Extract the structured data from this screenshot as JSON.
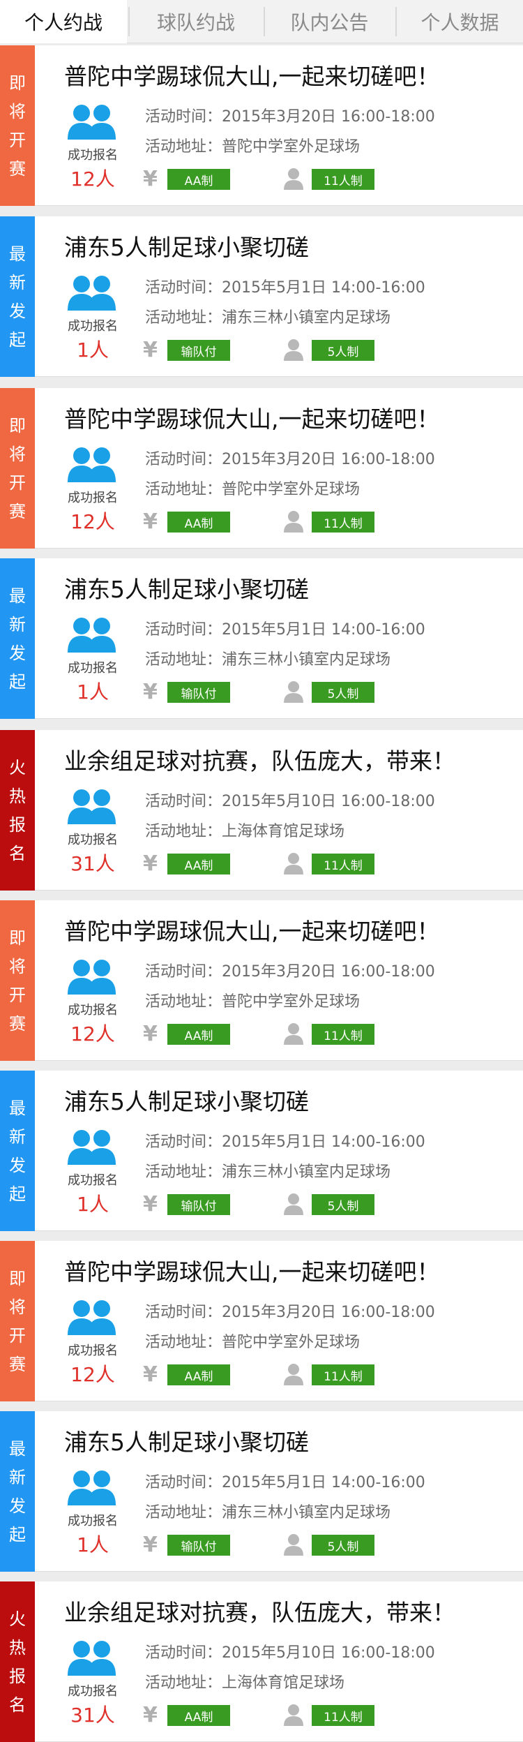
{
  "tabs": [
    "个人约战",
    "球队约战",
    "队内公告",
    "个人数据"
  ],
  "labels": {
    "time_prefix": "活动时间：",
    "address_prefix": "活动地址：",
    "signup": "成功报名",
    "yen": "¥"
  },
  "colors": {
    "status_upcoming": "#f06842",
    "status_new": "#2196f3",
    "status_hot": "#bb0d0d",
    "tag_green": "#3a9b22",
    "count_red": "#e0302a",
    "avatar_blue": "#1aa0e6"
  },
  "icons": [
    "team-avatar-icon",
    "yen-icon",
    "person-icon"
  ],
  "events": [
    {
      "status": [
        "即",
        "将",
        "开",
        "赛"
      ],
      "title": "普陀中学踢球侃大山,一起来切磋吧！",
      "time": "2015年3月20日 16:00-18:00",
      "address": "普陀中学室外足球场",
      "count": "12人",
      "fee": "AA制",
      "size": "11人制"
    },
    {
      "status": [
        "最",
        "新",
        "发",
        "起"
      ],
      "title": "浦东5人制足球小聚切磋",
      "time": "2015年5月1日 14:00-16:00",
      "address": "浦东三林小镇室内足球场",
      "count": "1人",
      "fee": "输队付",
      "size": "5人制"
    },
    {
      "status": [
        "即",
        "将",
        "开",
        "赛"
      ],
      "title": "普陀中学踢球侃大山,一起来切磋吧！",
      "time": "2015年3月20日 16:00-18:00",
      "address": "普陀中学室外足球场",
      "count": "12人",
      "fee": "AA制",
      "size": "11人制"
    },
    {
      "status": [
        "最",
        "新",
        "发",
        "起"
      ],
      "title": "浦东5人制足球小聚切磋",
      "time": "2015年5月1日 14:00-16:00",
      "address": "浦东三林小镇室内足球场",
      "count": "1人",
      "fee": "输队付",
      "size": "5人制"
    },
    {
      "status": [
        "火",
        "热",
        "报",
        "名"
      ],
      "title": "业余组足球对抗赛，队伍庞大，带来！",
      "time": "2015年5月10日 16:00-18:00",
      "address": "上海体育馆足球场",
      "count": "31人",
      "fee": "AA制",
      "size": "11人制"
    },
    {
      "status": [
        "即",
        "将",
        "开",
        "赛"
      ],
      "title": "普陀中学踢球侃大山,一起来切磋吧！",
      "time": "2015年3月20日 16:00-18:00",
      "address": "普陀中学室外足球场",
      "count": "12人",
      "fee": "AA制",
      "size": "11人制"
    },
    {
      "status": [
        "最",
        "新",
        "发",
        "起"
      ],
      "title": "浦东5人制足球小聚切磋",
      "time": "2015年5月1日 14:00-16:00",
      "address": "浦东三林小镇室内足球场",
      "count": "1人",
      "fee": "输队付",
      "size": "5人制"
    },
    {
      "status": [
        "即",
        "将",
        "开",
        "赛"
      ],
      "title": "普陀中学踢球侃大山,一起来切磋吧！",
      "time": "2015年3月20日 16:00-18:00",
      "address": "普陀中学室外足球场",
      "count": "12人",
      "fee": "AA制",
      "size": "11人制"
    },
    {
      "status": [
        "最",
        "新",
        "发",
        "起"
      ],
      "title": "浦东5人制足球小聚切磋",
      "time": "2015年5月1日 14:00-16:00",
      "address": "浦东三林小镇室内足球场",
      "count": "1人",
      "fee": "输队付",
      "size": "5人制"
    },
    {
      "status": [
        "火",
        "热",
        "报",
        "名"
      ],
      "title": "业余组足球对抗赛，队伍庞大，带来！",
      "time": "2015年5月10日 16:00-18:00",
      "address": "上海体育馆足球场",
      "count": "31人",
      "fee": "AA制",
      "size": "11人制"
    }
  ]
}
